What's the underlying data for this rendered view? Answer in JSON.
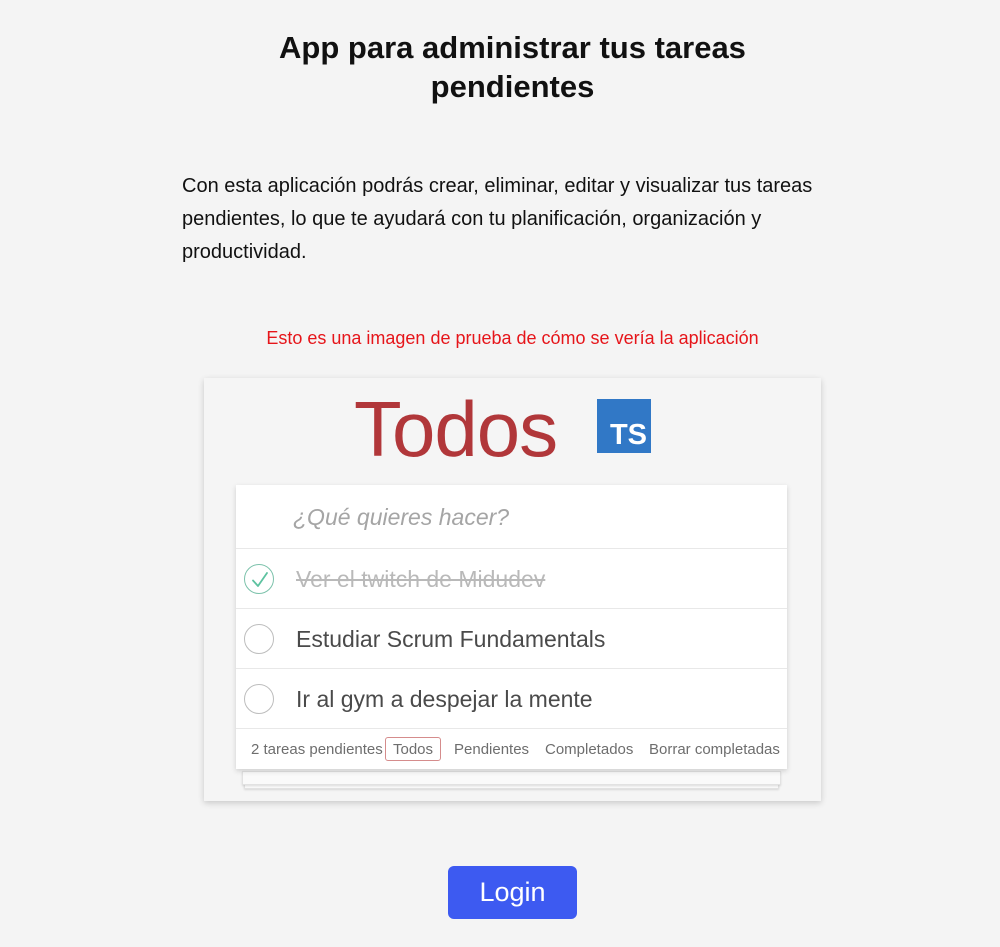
{
  "header": {
    "title": "App para administrar tus tareas pendientes"
  },
  "intro": {
    "description": "Con esta aplicación podrás crear, eliminar, editar y visualizar tus tareas pendientes, lo que te ayudará con tu planificación, organización y productividad."
  },
  "preview": {
    "note": "Esto es una imagen de prueba de cómo se vería la aplicación",
    "note_color": "#e6151a",
    "app_title": "Todos",
    "logo_text": "TS",
    "input": {
      "placeholder": "¿Qué quieres hacer?",
      "value": ""
    },
    "todos": [
      {
        "text": "Ver el twitch de Midudev",
        "completed": true
      },
      {
        "text": "Estudiar Scrum Fundamentals",
        "completed": false
      },
      {
        "text": "Ir al gym a despejar la mente",
        "completed": false
      }
    ],
    "footer": {
      "count_text": "2 tareas pendientes",
      "filters": [
        {
          "label": "Todos",
          "selected": true
        },
        {
          "label": "Pendientes",
          "selected": false
        },
        {
          "label": "Completados",
          "selected": false
        }
      ],
      "clear_label": "Borrar completadas"
    }
  },
  "actions": {
    "login_label": "Login",
    "button_color": "#3d5af1"
  }
}
